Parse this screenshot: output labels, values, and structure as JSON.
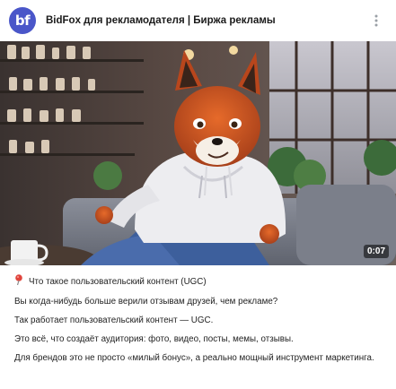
{
  "header": {
    "avatar_text": "bf",
    "title": "BidFox для рекламодателя | Биржа рекламы",
    "more_icon": "more-vertical-icon"
  },
  "media": {
    "duration": "0:07"
  },
  "colors": {
    "avatar_bg": "#4a56c9",
    "text": "#1f1f1f"
  },
  "post": {
    "lines": [
      "Что такое пользовательский контент (UGC)",
      "Вы когда-нибудь больше верили отзывам друзей, чем рекламе?",
      "Так работает пользовательский контент — UGC.",
      "Это всё, что создаёт аудитория: фото, видео, посты, мемы, отзывы.",
      "Для брендов это не просто «милый бонус», а реально мощный инструмент маркетинга."
    ],
    "first_line_icon": "pin-icon"
  }
}
